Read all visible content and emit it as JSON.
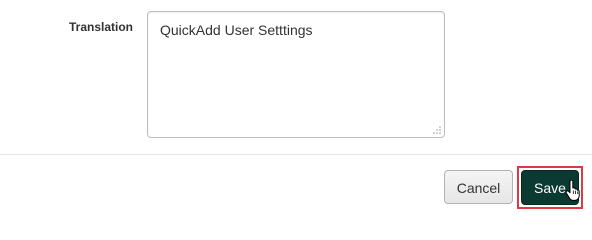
{
  "form": {
    "translation_label": "Translation",
    "translation_value": "QuickAdd User Setttings"
  },
  "actions": {
    "cancel_label": "Cancel",
    "save_label": "Save"
  },
  "colors": {
    "save_bg": "#0b3a32",
    "focus_outline": "#e0393e"
  },
  "icons": {
    "resize": "resize-grip-icon",
    "cursor": "hand-pointer-icon"
  }
}
